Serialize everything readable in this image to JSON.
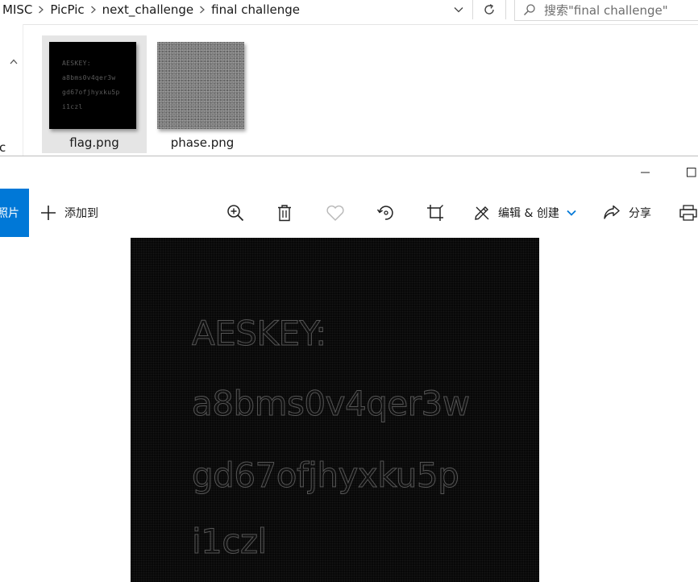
{
  "explorer": {
    "breadcrumbs": [
      "MISC",
      "PicPic",
      "next_challenge",
      "final challenge"
    ],
    "search_placeholder": "搜索\"final challenge\"",
    "left_nav_fragment": "c",
    "files": [
      {
        "name": "flag.png",
        "selected": true,
        "preview_lines": [
          "AESKEY:",
          "a8bms0v4qer3w",
          "gd67ofjhyxku5p",
          "i1czl"
        ]
      },
      {
        "name": "phase.png",
        "selected": false
      }
    ]
  },
  "viewer": {
    "left_tab_label": "照片",
    "add_to_label": "添加到",
    "edit_create_label": "编辑 & 创建",
    "share_label": "分享",
    "toolbar_icons": [
      "zoom-in-icon",
      "delete-icon",
      "favorite-icon",
      "rotate-icon",
      "crop-icon",
      "edit-icon",
      "share-icon",
      "print-icon"
    ],
    "image_lines": [
      "AESKEY:",
      "a8bms0v4qer3w",
      "gd67ofjhyxku5p",
      "i1czl"
    ]
  },
  "colors": {
    "accent": "#0078d7",
    "image_background": "#080808",
    "selection": "#e5e5e5"
  }
}
